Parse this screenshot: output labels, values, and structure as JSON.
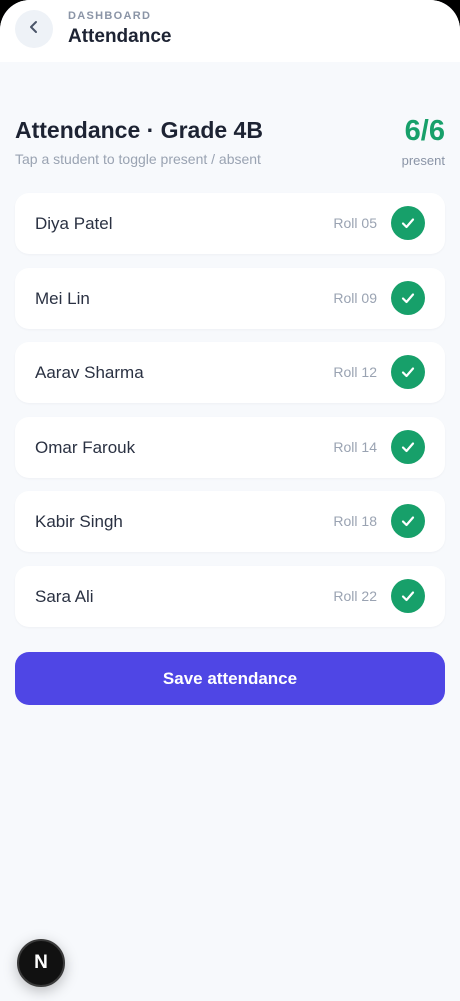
{
  "header": {
    "breadcrumb": "DASHBOARD",
    "title": "Attendance"
  },
  "main": {
    "heading": "Attendance · Grade 4B",
    "subheading": "Tap a student to toggle present / absent",
    "present_count": "6/6",
    "present_label": "present",
    "students": [
      {
        "name": "Diya Patel",
        "roll": "Roll 05",
        "status": "present"
      },
      {
        "name": "Mei Lin",
        "roll": "Roll 09",
        "status": "present"
      },
      {
        "name": "Aarav Sharma",
        "roll": "Roll 12",
        "status": "present"
      },
      {
        "name": "Omar Farouk",
        "roll": "Roll 14",
        "status": "present"
      },
      {
        "name": "Kabir Singh",
        "roll": "Roll 18",
        "status": "present"
      },
      {
        "name": "Sara Ali",
        "roll": "Roll 22",
        "status": "present"
      }
    ],
    "save_label": "Save attendance"
  },
  "fab": {
    "label": "N"
  },
  "icons": {
    "back": "chevron-left-icon",
    "present": "check-icon"
  },
  "colors": {
    "accent": "#4f46e5",
    "present": "#17a06a",
    "background": "#f7f9fc"
  }
}
